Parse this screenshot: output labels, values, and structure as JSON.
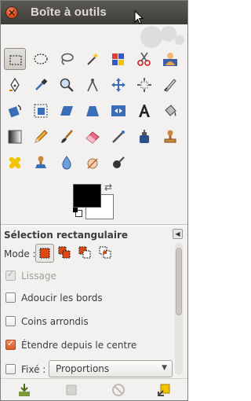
{
  "window": {
    "title": "Boîte à outils"
  },
  "tools": [
    {
      "name": "rect-select"
    },
    {
      "name": "ellipse-select"
    },
    {
      "name": "free-select"
    },
    {
      "name": "fuzzy-select"
    },
    {
      "name": "select-by-color"
    },
    {
      "name": "scissors-select"
    },
    {
      "name": "foreground-select"
    },
    {
      "name": "paths"
    },
    {
      "name": "color-picker"
    },
    {
      "name": "zoom"
    },
    {
      "name": "measure"
    },
    {
      "name": "move"
    },
    {
      "name": "align"
    },
    {
      "name": "crop"
    },
    {
      "name": "rotate"
    },
    {
      "name": "scale"
    },
    {
      "name": "shear"
    },
    {
      "name": "perspective"
    },
    {
      "name": "flip"
    },
    {
      "name": "text"
    },
    {
      "name": "bucket-fill"
    },
    {
      "name": "blend"
    },
    {
      "name": "pencil"
    },
    {
      "name": "paintbrush"
    },
    {
      "name": "eraser"
    },
    {
      "name": "airbrush"
    },
    {
      "name": "ink"
    },
    {
      "name": "clone"
    },
    {
      "name": "heal"
    },
    {
      "name": "perspective-clone"
    },
    {
      "name": "blur-sharpen"
    },
    {
      "name": "smudge"
    },
    {
      "name": "dodge-burn"
    }
  ],
  "colors": {
    "foreground": "#000000",
    "background": "#ffffff"
  },
  "options": {
    "title": "Sélection rectangulaire",
    "mode_label": "Mode :",
    "antialias": "Lissage",
    "feather": "Adoucir les bords",
    "rounded": "Coins arrondis",
    "expand_center": "Étendre depuis le centre",
    "fixed": "Fixé :",
    "fixed_value": "Proportions"
  },
  "accent": "#dd4814"
}
